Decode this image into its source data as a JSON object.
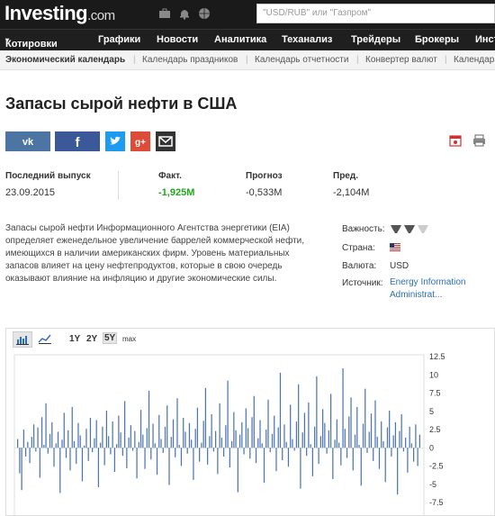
{
  "header": {
    "logo_main": "Investing",
    "logo_domain": ".com",
    "search_placeholder": "\"USD/RUB\" или \"Газпром\""
  },
  "nav": {
    "items": [
      "Котировки",
      "Графики",
      "Новости",
      "Аналитика",
      "Теханализ",
      "Трейдеры",
      "Брокеры",
      "Инст"
    ]
  },
  "subnav": {
    "items": [
      "Экономический календарь",
      "Календарь праздников",
      "Календарь отчетности",
      "Конвертер валют",
      "Календар"
    ]
  },
  "page": {
    "title": "Запасы сырой нефти в США"
  },
  "stats": {
    "latest_label": "Последний выпуск",
    "latest_date": "23.09.2015",
    "actual_label": "Факт.",
    "actual_value": "-1,925M",
    "forecast_label": "Прогноз",
    "forecast_value": "-0,533M",
    "previous_label": "Пред.",
    "previous_value": "-2,104M"
  },
  "description": "Запасы сырой нефти Информационного Агентства энергетики (EIA) определяет еженедельное увеличение баррелей коммерческой нефти, имеющихся в наличии американских фирм. Уровень материальных запасов влияет на цену нефтепродуктов, которые в свою очередь оказывают влияние на инфляцию и другие экономические силы.",
  "info": {
    "importance_label": "Важность:",
    "importance_level": 2,
    "country_label": "Страна:",
    "currency_label": "Валюта:",
    "currency_value": "USD",
    "source_label": "Источник:",
    "source_line1": "Energy Information",
    "source_line2": "Administrat..."
  },
  "chart_toolbar": {
    "ranges": [
      "1Y",
      "2Y",
      "5Y",
      "max"
    ],
    "active": "5Y"
  },
  "colors": {
    "bar": "#4a74b4",
    "positive": "#21a81c",
    "topbar": "#1a1a1a",
    "link": "#2c6fb4"
  },
  "chart_data": {
    "type": "bar",
    "ylim": [
      -8.5,
      12.5
    ],
    "yticks": [
      "12.5",
      "10",
      "7.5",
      "5",
      "2.5",
      "0",
      "-2.5",
      "-5",
      "-7.5"
    ],
    "ytick_values": [
      12.5,
      10,
      7.5,
      5,
      2.5,
      0,
      -2.5,
      -5,
      -7.5
    ],
    "values": [
      1.2,
      -3.5,
      -5.8,
      2.5,
      -1.2,
      0.8,
      -2.1,
      1.5,
      3.2,
      -0.5,
      2.8,
      -4.1,
      4.2,
      0.4,
      6.1,
      -0.8,
      1.9,
      3.5,
      -2.6,
      0.6,
      2.2,
      -6.2,
      1.1,
      4.8,
      -1.4,
      2.4,
      -3.1,
      5.6,
      0.9,
      -2.2,
      3.4,
      1.7,
      -4.6,
      0.3,
      2.6,
      -1.8,
      4.1,
      -0.6,
      1.3,
      3.8,
      -5.4,
      0.7,
      2.9,
      -2.4,
      5.1,
      1.6,
      -0.9,
      3.6,
      -3.3,
      0.5,
      4.4,
      2.1,
      -1.1,
      6.4,
      -2.8,
      1.4,
      3.1,
      -0.4,
      2.3,
      -4.2,
      0.8,
      5.2,
      1.8,
      -2.9,
      2.7,
      7.8,
      -1.6,
      3.3,
      0.6,
      -3.7,
      4.5,
      1.2,
      -0.7,
      2.9,
      5.8,
      -5.1,
      1.5,
      3.9,
      -1.3,
      6.8,
      0.4,
      -2.5,
      4.1,
      2.2,
      -0.8,
      3.4,
      1.1,
      -4.4,
      2.6,
      5.5,
      -1.9,
      0.7,
      3.7,
      8.2,
      -2.3,
      1.6,
      4.6,
      -0.5,
      2.3,
      -3.6,
      6.1,
      1.4,
      -1.2,
      3.1,
      9.2,
      -2.7,
      0.9,
      4.9,
      2.4,
      -6.1,
      1.8,
      3.5,
      -0.9,
      5.4,
      2.7,
      -1.5,
      4.2,
      7.1,
      -2.1,
      1.3,
      3.8,
      0.6,
      -4.8,
      2.5,
      6.6,
      -0.6,
      1.9,
      4.4,
      -3.2,
      2.8,
      10.3,
      -1.7,
      3.2,
      0.8,
      -2.6,
      5.9,
      1.2,
      -0.4,
      3.6,
      8.7,
      -5.6,
      2.1,
      4.8,
      -1.1,
      6.2,
      0.5,
      -3.9,
      2.9,
      9.8,
      -2.2,
      1.6,
      5.3,
      3.4,
      -0.8,
      2.4,
      7.4,
      -4.3,
      1.1,
      3.9,
      0.7,
      -2.4,
      10.9,
      2.6,
      -1.4,
      4.3,
      6.9,
      -3.1,
      1.8,
      5.6,
      0.4,
      -5.2,
      3.3,
      8.1,
      -0.7,
      2.2,
      4.7,
      -1.8,
      6.5,
      1.5,
      -2.9,
      3.6,
      0.9,
      -4.7,
      2.8,
      5.1,
      -1.2,
      1.7,
      3.5,
      -6.4,
      2.3,
      4.6,
      -0.5,
      1.4,
      -3.4,
      2.9,
      0.6,
      -1.9,
      3.2,
      -2.5,
      1.8
    ]
  }
}
